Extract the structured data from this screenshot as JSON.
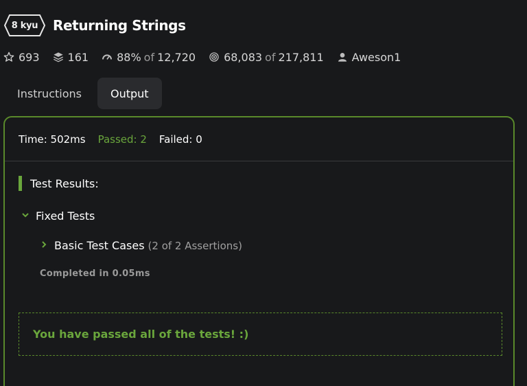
{
  "kata": {
    "rank": "8 kyu",
    "title": "Returning Strings"
  },
  "stats": {
    "stars": "693",
    "collections": "161",
    "satisfaction": "88%",
    "satisfaction_of": "of",
    "votes": "12,720",
    "completed": "68,083",
    "completed_of": "of",
    "attempts": "217,811",
    "author": "Aweson1"
  },
  "tabs": [
    {
      "label": "Instructions"
    },
    {
      "label": "Output"
    }
  ],
  "output": {
    "time": "Time: 502ms",
    "passed": "Passed: 2",
    "failed": "Failed: 0",
    "results_heading": "Test Results:",
    "group_label": "Fixed Tests",
    "case_label": "Basic Test Cases",
    "case_assertions": "(2 of 2 Assertions)",
    "completed_in": "Completed in 0.05ms",
    "success_message": "You have passed all of the tests! :)"
  },
  "colors": {
    "accent_green": "#6aa63c",
    "background": "#18191b",
    "panel_border": "#5a8a2b"
  }
}
